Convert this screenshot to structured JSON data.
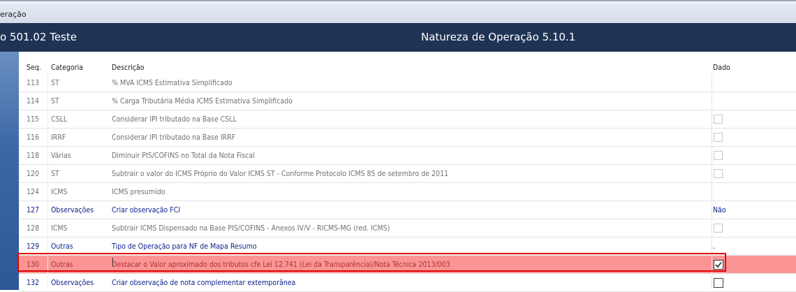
{
  "window": {
    "title": "eração"
  },
  "header": {
    "left_title": "o 501.02  Teste",
    "center_title": "Natureza de Operação 5.10.1"
  },
  "columns": {
    "seq": "Seq.",
    "categoria": "Categoria",
    "descricao": "Descrição",
    "dado": "Dado"
  },
  "rows": [
    {
      "seq": "113",
      "categoria": "ST",
      "descricao": "% MVA ICMS Estimativa Simplificado",
      "dado": "",
      "style": "gray"
    },
    {
      "seq": "114",
      "categoria": "ST",
      "descricao": "% Carga Tributária Média ICMS Estimativa Simplificado",
      "dado": "",
      "style": "gray"
    },
    {
      "seq": "115",
      "categoria": "CSLL",
      "descricao": "Considerar IPI tributado na Base CSLL",
      "dado": "",
      "style": "gray",
      "checkbox": "unchecked-disabled"
    },
    {
      "seq": "116",
      "categoria": "IRRF",
      "descricao": "Considerar IPI tributado na Base IRRF",
      "dado": "",
      "style": "gray",
      "checkbox": "unchecked-disabled"
    },
    {
      "seq": "118",
      "categoria": "Várias",
      "descricao": "Diminuir PIS/COFINS no Total da Nota Fiscal",
      "dado": "",
      "style": "gray",
      "checkbox": "unchecked-disabled"
    },
    {
      "seq": "120",
      "categoria": "ST",
      "descricao": "Subtrair o valor do ICMS Próprio do Valor ICMS ST - Conforme Protocolo ICMS 85 de setembro de 2011",
      "dado": "",
      "style": "gray",
      "checkbox": "unchecked-disabled"
    },
    {
      "seq": "124",
      "categoria": "ICMS",
      "descricao": "ICMS presumido",
      "dado": "",
      "style": "gray"
    },
    {
      "seq": "127",
      "categoria": "Observações",
      "descricao": "Criar observação FCI",
      "dado": "Não",
      "style": "blue"
    },
    {
      "seq": "128",
      "categoria": "ICMS",
      "descricao": "Subtrair ICMS Dispensado na Base PIS/COFINS - Anexos IV/V - RICMS-MG (red. ICMS)",
      "dado": "",
      "style": "gray",
      "checkbox": "unchecked-disabled"
    },
    {
      "seq": "129",
      "categoria": "Outras",
      "descricao": "Tipo de Operação para NF de Mapa Resumo",
      "dado": ".",
      "style": "blue"
    },
    {
      "seq": "130",
      "categoria": "Outras",
      "descricao": "Destacar o Valor aproximado dos tributos cfe Lei 12.741 (Lei da Transparência)/Nota Técnica 2013/003",
      "dado": "",
      "style": "selected",
      "checkbox": "checked"
    },
    {
      "seq": "132",
      "categoria": "Observações",
      "descricao": "Criar observação de nota complementar extemporânea",
      "dado": "",
      "style": "blue",
      "checkbox": "unchecked"
    }
  ],
  "colors": {
    "header_bg": "#1f3355",
    "selected_row": "#fb9595",
    "highlight_border": "#e10000",
    "active_text": "#0b1f8a",
    "inactive_text": "#707070"
  }
}
